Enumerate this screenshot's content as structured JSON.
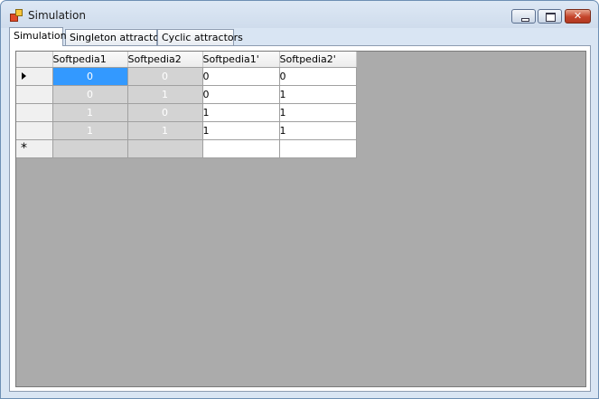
{
  "window": {
    "title": "Simulation",
    "icon": "app-icon",
    "controls": [
      "minimize-icon",
      "maximize-icon",
      "close-icon"
    ]
  },
  "tabs": [
    {
      "label": "Simulation",
      "active": true
    },
    {
      "label": "Singleton attractors",
      "active": false
    },
    {
      "label": "Cyclic attractors",
      "active": false
    }
  ],
  "grid": {
    "columns": [
      "Softpedia1",
      "Softpedia2",
      "Softpedia1'",
      "Softpedia2'"
    ],
    "rows": [
      [
        "0",
        "0",
        "0",
        "0"
      ],
      [
        "0",
        "1",
        "0",
        "1"
      ],
      [
        "1",
        "0",
        "1",
        "1"
      ],
      [
        "1",
        "1",
        "1",
        "1"
      ]
    ],
    "new_row_glyph": "*",
    "current_row_indicator": "row-pointer-icon",
    "colors": {
      "background": "#ababab",
      "readonly_cell": "#d3d3d3",
      "selected_cell": "#3399ff"
    }
  }
}
